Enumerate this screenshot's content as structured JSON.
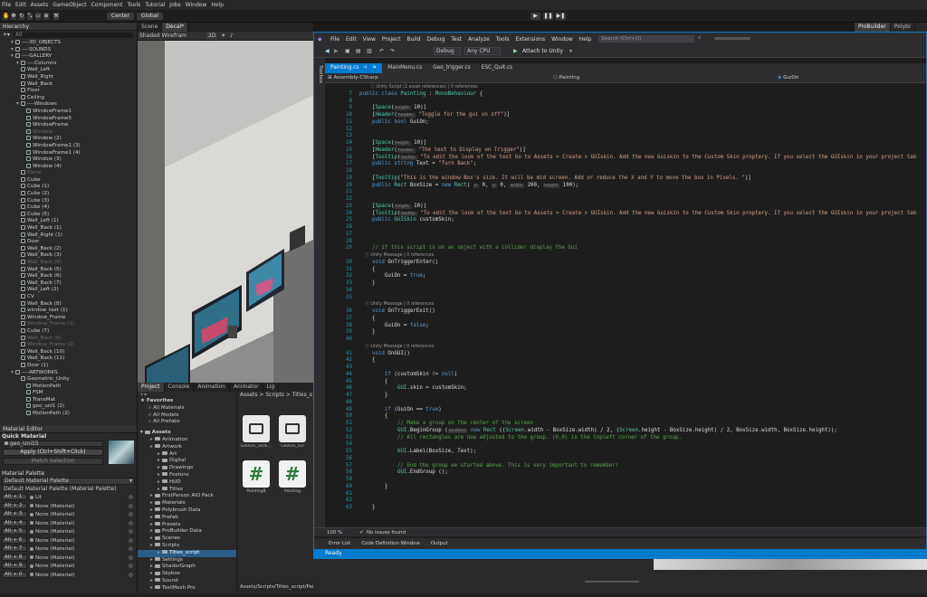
{
  "unity": {
    "menu": [
      "File",
      "Edit",
      "Assets",
      "GameObject",
      "Component",
      "Tools",
      "Tutorial",
      "Jobs",
      "Window",
      "Help"
    ],
    "toolbar": {
      "center": "Center",
      "global": "Global",
      "probuilder": "ProBuilder",
      "polybrush": "Polybr"
    },
    "hierarchy": {
      "title": "Hierarchy",
      "search": "All",
      "rows": [
        {
          "t": "----3D_OBJECTS",
          "i": 2,
          "d": false
        },
        {
          "t": "----SOUNDS",
          "i": 2,
          "d": false
        },
        {
          "t": "----GALLERY",
          "i": 2,
          "d": false
        },
        {
          "t": "----Columns",
          "i": 3,
          "d": false
        },
        {
          "t": "Wall_Left",
          "i": 3,
          "d": false
        },
        {
          "t": "Wall_Right",
          "i": 3,
          "d": false
        },
        {
          "t": "Wall_Back",
          "i": 3,
          "d": false
        },
        {
          "t": "Floor",
          "i": 3,
          "d": false
        },
        {
          "t": "Ceiling",
          "i": 3,
          "d": false
        },
        {
          "t": "----Windows",
          "i": 3,
          "d": false
        },
        {
          "t": "WindowFrame1",
          "i": 4,
          "d": false
        },
        {
          "t": "WindowFrame5",
          "i": 4,
          "d": false
        },
        {
          "t": "WindowFrame",
          "i": 4,
          "d": false
        },
        {
          "t": "Window",
          "i": 4,
          "d": true
        },
        {
          "t": "Window (2)",
          "i": 4,
          "d": false
        },
        {
          "t": "WindowFrame1 (3)",
          "i": 4,
          "d": false
        },
        {
          "t": "WindowFrame1 (4)",
          "i": 4,
          "d": false
        },
        {
          "t": "Window (3)",
          "i": 4,
          "d": false
        },
        {
          "t": "Window (4)",
          "i": 4,
          "d": false
        },
        {
          "t": "Plane",
          "i": 3,
          "d": true
        },
        {
          "t": "Cube",
          "i": 3,
          "d": false
        },
        {
          "t": "Cube (1)",
          "i": 3,
          "d": false
        },
        {
          "t": "Cube (2)",
          "i": 3,
          "d": false
        },
        {
          "t": "Cube (3)",
          "i": 3,
          "d": false
        },
        {
          "t": "Cube (4)",
          "i": 3,
          "d": false
        },
        {
          "t": "Cube (5)",
          "i": 3,
          "d": false
        },
        {
          "t": "Wall_Left (1)",
          "i": 3,
          "d": false
        },
        {
          "t": "Wall_Back (1)",
          "i": 3,
          "d": false
        },
        {
          "t": "Wall_Right (1)",
          "i": 3,
          "d": false
        },
        {
          "t": "Door",
          "i": 3,
          "d": false
        },
        {
          "t": "Wall_Back (2)",
          "i": 3,
          "d": false
        },
        {
          "t": "Wall_Back (3)",
          "i": 3,
          "d": false
        },
        {
          "t": "Wall_Back (4)",
          "i": 3,
          "d": true
        },
        {
          "t": "Wall_Back (5)",
          "i": 3,
          "d": false
        },
        {
          "t": "Wall_Back (6)",
          "i": 3,
          "d": false
        },
        {
          "t": "Wall_Back (7)",
          "i": 3,
          "d": false
        },
        {
          "t": "Wall_Left (2)",
          "i": 3,
          "d": false
        },
        {
          "t": "CV",
          "i": 3,
          "d": false
        },
        {
          "t": "Wall_Back (8)",
          "i": 3,
          "d": false
        },
        {
          "t": "window_text (1)",
          "i": 3,
          "d": false
        },
        {
          "t": "Window_Frame",
          "i": 3,
          "d": false
        },
        {
          "t": "Window_Frame (1)",
          "i": 3,
          "d": true
        },
        {
          "t": "Cube (7)",
          "i": 3,
          "d": false
        },
        {
          "t": "Wall_Back (9)",
          "i": 3,
          "d": true
        },
        {
          "t": "Window_Frame (2)",
          "i": 3,
          "d": true
        },
        {
          "t": "Wall_Back (10)",
          "i": 3,
          "d": false
        },
        {
          "t": "Wall_Back (11)",
          "i": 3,
          "d": false
        },
        {
          "t": "Door (1)",
          "i": 3,
          "d": false
        },
        {
          "t": "----ARTWORKS",
          "i": 2,
          "d": false
        },
        {
          "t": "Geometric_Unity",
          "i": 3,
          "d": false
        },
        {
          "t": "MotionPath",
          "i": 4,
          "d": false
        },
        {
          "t": "FSM",
          "i": 4,
          "d": false
        },
        {
          "t": "TransMat",
          "i": 4,
          "d": false
        },
        {
          "t": "geo_uni1 (2)",
          "i": 4,
          "d": false
        },
        {
          "t": "MotionPath (2)",
          "i": 4,
          "d": false
        }
      ]
    },
    "material_editor": {
      "title": "Material Editor",
      "quick": "Quick Material",
      "material": "geo_Uni15",
      "apply": "Apply (Ctrl+Shift+Click)",
      "match": "Match Selection",
      "palette_title": "Material Palette",
      "palette_select": "Default Material Palette",
      "palette_name": "Default Material Palette (Material Palette)",
      "slots": [
        {
          "k": "Alt + 1",
          "v": "Lit"
        },
        {
          "k": "Alt + 2",
          "v": "None (Material)"
        },
        {
          "k": "Alt + 3",
          "v": "None (Material)"
        },
        {
          "k": "Alt + 4",
          "v": "None (Material)"
        },
        {
          "k": "Alt + 5",
          "v": "None (Material)"
        },
        {
          "k": "Alt + 6",
          "v": "None (Material)"
        },
        {
          "k": "Alt + 7",
          "v": "None (Material)"
        },
        {
          "k": "Alt + 8",
          "v": "None (Material)"
        },
        {
          "k": "Alt + 9",
          "v": "None (Material)"
        },
        {
          "k": "Alt + 0",
          "v": "None (Material)"
        }
      ]
    },
    "scene": {
      "tabs": [
        "Scene",
        "Decal*"
      ],
      "shading": "Shaded Wirefram",
      "mode2d": "2D"
    },
    "project": {
      "tabs": [
        "Project",
        "Console",
        "Animation",
        "Animator",
        "Lig"
      ],
      "favorites": "Favorites",
      "fav_items": [
        "All Materials",
        "All Models",
        "All Prefabs"
      ],
      "assets": "Assets",
      "tree": [
        {
          "t": "Animation",
          "i": 1
        },
        {
          "t": "Artwork",
          "i": 1
        },
        {
          "t": "Art",
          "i": 2
        },
        {
          "t": "Digital",
          "i": 2
        },
        {
          "t": "Drawings",
          "i": 2
        },
        {
          "t": "Foxtons",
          "i": 2
        },
        {
          "t": "HUD",
          "i": 2
        },
        {
          "t": "Titles",
          "i": 2
        },
        {
          "t": "FirstPerson AIO Pack",
          "i": 1
        },
        {
          "t": "Materials",
          "i": 1
        },
        {
          "t": "Polybrush Data",
          "i": 1
        },
        {
          "t": "Prefab",
          "i": 1
        },
        {
          "t": "Presets",
          "i": 1
        },
        {
          "t": "ProBuilder Data",
          "i": 1
        },
        {
          "t": "Scenes",
          "i": 1
        },
        {
          "t": "Scripts",
          "i": 1
        },
        {
          "t": "Titles_script",
          "i": 2
        },
        {
          "t": "Settings",
          "i": 1
        },
        {
          "t": "ShaderGraph",
          "i": 1
        },
        {
          "t": "Skybox",
          "i": 1
        },
        {
          "t": "Sound",
          "i": 1
        },
        {
          "t": "TextMesh Pro",
          "i": 1
        }
      ],
      "breadcrumb": "Assets > Scripts > Titles_s",
      "files": [
        "GeoUni_GUIS...",
        "GeoUni_GU",
        "PaintingB",
        "Painting"
      ],
      "footer_path": "Assets/Scripts/Titles_script/Painting.cs"
    }
  },
  "vs": {
    "menu": [
      "File",
      "Edit",
      "View",
      "Project",
      "Build",
      "Debug",
      "Test",
      "Analyze",
      "Tools",
      "Extensions",
      "Window",
      "Help"
    ],
    "search": "Search (Ctrl+Q)",
    "config": "Debug",
    "platform": "Any CPU",
    "attach": "Attach to Unity",
    "tabs": [
      "Painting.cs",
      "MainMenu.cs",
      "Geo_trigger.cs",
      "ESC_Quit.cs"
    ],
    "nav_project": "Assembly-CSharp",
    "nav_class": "Painting",
    "nav_member": "GuiOn",
    "sidebar_label": "Toolbox",
    "zoom": "100 %",
    "issues": "No issues found",
    "bottom_tabs": [
      "Error List",
      "Code Definition Window",
      "Output"
    ],
    "status": "Ready",
    "lines": [
      {
        "n": "",
        "h": "<span class='ref'>        ⓘ Unity Script (2 asset references) | 0 references</span>"
      },
      {
        "n": "7",
        "h": "<span class='kw'>public class</span> <span class='ty'>Painting</span> <span class='pl'>: </span><span class='ty'>MonoBehaviour</span><span class='pl'> {</span>"
      },
      {
        "n": "8",
        "h": ""
      },
      {
        "n": "9",
        "h": "<span class='pl'>    [</span><span class='ty'>Space</span><span class='pl'>(</span><span class='hint'>height:</span><span class='pl'> 10)]</span>"
      },
      {
        "n": "10",
        "h": "<span class='pl'>    [</span><span class='ty'>Header</span><span class='pl'>(</span><span class='hint'>header:</span><span class='st'> \"Toggle for the gui on off\"</span><span class='pl'>)]</span>"
      },
      {
        "n": "11",
        "h": "<span class='kw'>    public bool</span><span class='pl'> GuiOn;</span>"
      },
      {
        "n": "12",
        "h": ""
      },
      {
        "n": "13",
        "h": ""
      },
      {
        "n": "14",
        "h": "<span class='pl'>    [</span><span class='ty'>Space</span><span class='pl'>(</span><span class='hint'>height:</span><span class='pl'> 10)]</span>"
      },
      {
        "n": "15",
        "h": "<span class='pl'>    [</span><span class='ty'>Header</span><span class='pl'>(</span><span class='hint'>header:</span><span class='st'> \"The text to Display on Trigger\"</span><span class='pl'>)]</span>"
      },
      {
        "n": "16",
        "h": "<span class='pl'>    [</span><span class='ty'>Tooltip</span><span class='pl'>(</span><span class='hint'>tooltip:</span><span class='st'> \"To edit the look of the text Go to Assets > Create > GUIskin. Add the new Guiskin to the Custom Skin proptery. If you select the GUIskin in your project tab</span>"
      },
      {
        "n": "17",
        "h": "<span class='kw'>    public string</span><span class='pl'> Text = </span><span class='st'>\"Turn Back\"</span><span class='pl'>;</span>"
      },
      {
        "n": "18",
        "h": ""
      },
      {
        "n": "19",
        "h": "<span class='pl'>    [</span><span class='ty'>Tooltip</span><span class='pl'>(</span><span class='st'>\"This is the window Box's size. It will be mid screen. Add or reduce the X and Y to move the box in Pixels. \"</span><span class='pl'>)]</span>"
      },
      {
        "n": "20",
        "h": "<span class='kw'>    public</span> <span class='ty'>Rect</span><span class='pl'> BoxSize = </span><span class='kw'>new</span> <span class='ty'>Rect</span><span class='pl'>( </span><span class='hint'>x:</span><span class='pl'> 0, </span><span class='hint'>y:</span><span class='pl'> 0, </span><span class='hint'>width:</span><span class='pl'> 200, </span><span class='hint'>height:</span><span class='pl'> 100);</span>"
      },
      {
        "n": "21",
        "h": ""
      },
      {
        "n": "22",
        "h": ""
      },
      {
        "n": "23",
        "h": "<span class='pl'>    [</span><span class='ty'>Space</span><span class='pl'>(</span><span class='hint'>height:</span><span class='pl'> 10)]</span>"
      },
      {
        "n": "24",
        "h": "<span class='pl'>    [</span><span class='ty'>Tooltip</span><span class='pl'>(</span><span class='hint'>tooltip:</span><span class='st'> \"To edit the look of the text Go to Assets > Create > GUIskin. Add the new Guiskin to the Custom Skin proptery. If you select the GUIskin in your project tab</span>"
      },
      {
        "n": "25",
        "h": "<span class='kw'>    public</span> <span class='ty'>GUISkin</span><span class='pl'> customSkin;</span>"
      },
      {
        "n": "26",
        "h": ""
      },
      {
        "n": "27",
        "h": ""
      },
      {
        "n": "28",
        "h": ""
      },
      {
        "n": "29",
        "h": "<span class='cm'>    // if this script is on an object with a collider display the Gui</span>"
      },
      {
        "n": "",
        "h": "<span class='ref'>    ⓘ Unity Message | 0 references</span>"
      },
      {
        "n": "30",
        "h": "<span class='kw'>    void</span><span class='pl'> OnTriggerEnter()</span>"
      },
      {
        "n": "31",
        "h": "<span class='pl'>    {</span>"
      },
      {
        "n": "32",
        "h": "<span class='pl'>        GuiOn = </span><span class='kw'>true</span><span class='pl'>;</span>"
      },
      {
        "n": "33",
        "h": "<span class='pl'>    }</span>"
      },
      {
        "n": "34",
        "h": ""
      },
      {
        "n": "35",
        "h": ""
      },
      {
        "n": "",
        "h": "<span class='ref'>    ⓘ Unity Message | 0 references</span>"
      },
      {
        "n": "36",
        "h": "<span class='kw'>    void</span><span class='pl'> OnTriggerExit()</span>"
      },
      {
        "n": "37",
        "h": "<span class='pl'>    {</span>"
      },
      {
        "n": "38",
        "h": "<span class='pl'>        GuiOn = </span><span class='kw'>false</span><span class='pl'>;</span>"
      },
      {
        "n": "39",
        "h": "<span class='pl'>    }</span>"
      },
      {
        "n": "40",
        "h": ""
      },
      {
        "n": "",
        "h": "<span class='ref'>    ⓘ Unity Message | 0 references</span>"
      },
      {
        "n": "41",
        "h": "<span class='kw'>    void</span><span class='pl'> OnGUI()</span>"
      },
      {
        "n": "42",
        "h": "<span class='pl'>    {</span>"
      },
      {
        "n": "43",
        "h": ""
      },
      {
        "n": "44",
        "h": "<span class='kw'>        if</span><span class='pl'> (customSkin != </span><span class='kw'>null</span><span class='pl'>)</span>"
      },
      {
        "n": "45",
        "h": "<span class='pl'>        {</span>"
      },
      {
        "n": "46",
        "h": "<span class='ty'>            GUI</span><span class='pl'>.skin = customSkin;</span>"
      },
      {
        "n": "47",
        "h": "<span class='pl'>        }</span>"
      },
      {
        "n": "48",
        "h": ""
      },
      {
        "n": "49",
        "h": "<span class='kw'>        if</span><span class='pl'> (GuiOn == </span><span class='kw'>true</span><span class='pl'>)</span>"
      },
      {
        "n": "50",
        "h": "<span class='pl'>        {</span>"
      },
      {
        "n": "51",
        "h": "<span class='cm'>            // Make a group on the center of the screen</span>"
      },
      {
        "n": "52",
        "h": "<span class='ty'>            GUI</span><span class='pl'>.BeginGroup (</span><span class='hint'>position:</span><span class='kw'> new</span> <span class='ty'>Rect</span><span class='pl'> ((</span><span class='ty'>Screen</span><span class='pl'>.width - BoxSize.width) / 2, (</span><span class='ty'>Screen</span><span class='pl'>.height - BoxSize.height) / 2, BoxSize.width, BoxSize.height));</span>"
      },
      {
        "n": "53",
        "h": "<span class='cm'>            // All rectangles are now adjusted to the group. (0,0) is the topleft corner of the group.</span>"
      },
      {
        "n": "54",
        "h": ""
      },
      {
        "n": "55",
        "h": "<span class='ty'>            GUI</span><span class='pl'>.Label(BoxSize, Text);</span>"
      },
      {
        "n": "56",
        "h": ""
      },
      {
        "n": "57",
        "h": "<span class='cm'>            // End the group we started above. This is very important to remember!</span>"
      },
      {
        "n": "58",
        "h": "<span class='ty'>            GUI</span><span class='pl'>.EndGroup ();</span>"
      },
      {
        "n": "59",
        "h": ""
      },
      {
        "n": "60",
        "h": "<span class='pl'>        }</span>"
      },
      {
        "n": "61",
        "h": ""
      },
      {
        "n": "62",
        "h": ""
      },
      {
        "n": "63",
        "h": "<span class='pl'>    }</span>"
      }
    ]
  }
}
